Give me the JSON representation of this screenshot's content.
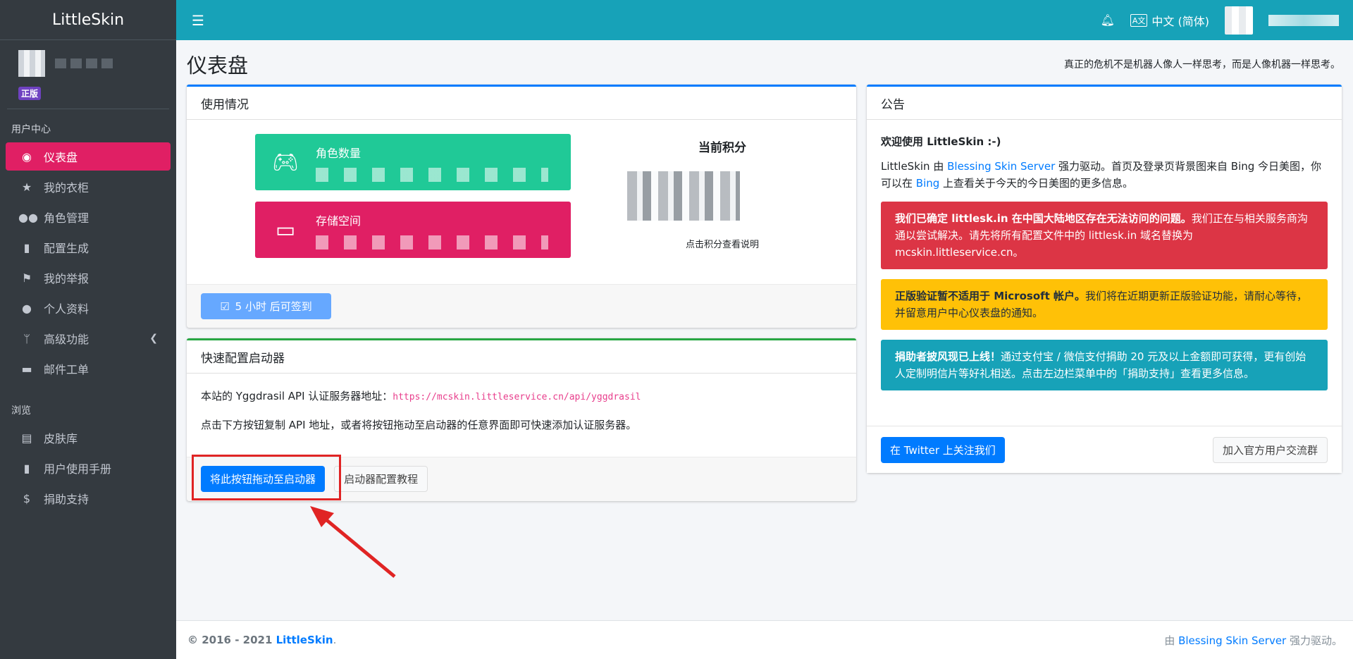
{
  "brand": "LittleSkin",
  "user": {
    "badge": "正版"
  },
  "topbar": {
    "menu_icon": "hamburger-icon",
    "language": "中文 (简体)",
    "language_icon": "translate-icon",
    "bell_icon": "bell-icon"
  },
  "nav": {
    "header_user": "用户中心",
    "items": [
      {
        "label": "仪表盘",
        "icon": "dashboard-icon"
      },
      {
        "label": "我的衣柜",
        "icon": "star-icon"
      },
      {
        "label": "角色管理",
        "icon": "users-icon"
      },
      {
        "label": "配置生成",
        "icon": "book-icon"
      },
      {
        "label": "我的举报",
        "icon": "flag-icon"
      },
      {
        "label": "个人资料",
        "icon": "user-icon"
      },
      {
        "label": "高级功能",
        "icon": "branch-icon"
      },
      {
        "label": "邮件工单",
        "icon": "ticket-icon"
      }
    ],
    "header_browse": "浏览",
    "browse_items": [
      {
        "label": "皮肤库",
        "icon": "archive-icon"
      },
      {
        "label": "用户使用手册",
        "icon": "manual-icon"
      },
      {
        "label": "捐助支持",
        "icon": "donate-icon"
      }
    ]
  },
  "page": {
    "title": "仪表盘",
    "quote": "真正的危机不是机器人像人一样思考，而是人像机器一样思考。"
  },
  "usage": {
    "title": "使用情况",
    "characters_label": "角色数量",
    "storage_label": "存储空间",
    "score_title": "当前积分",
    "score_note": "点击积分查看说明",
    "checkin_button": "5 小时 后可签到"
  },
  "launcher": {
    "title": "快速配置启动器",
    "api_text": "本站的 Yggdrasil API 认证服务器地址：",
    "api_url": "https://mcskin.littleservice.cn/api/yggdrasil",
    "instruction": "点击下方按钮复制 API 地址，或者将按钮拖动至启动器的任意界面即可快速添加认证服务器。",
    "drag_button": "将此按钮拖动至启动器",
    "tutorial_button": "启动器配置教程"
  },
  "announcement": {
    "title": "公告",
    "welcome": "欢迎使用 LittleSkin :-)",
    "intro_1": "LittleSkin 由 ",
    "intro_link_1": "Blessing Skin Server",
    "intro_2": " 强力驱动。首页及登录页背景图来自 Bing 今日美图，你可以在 ",
    "intro_link_2": "Bing",
    "intro_3": " 上查看关于今天的今日美图的更多信息。",
    "alert_danger_bold": "我们已确定 littlesk.in 在中国大陆地区存在无法访问的问题。",
    "alert_danger_text": "我们正在与相关服务商沟通以尝试解决。请先将所有配置文件中的 littlesk.in 域名替换为 mcskin.littleservice.cn。",
    "alert_warning_bold": "正版验证暂不适用于 Microsoft 帐户。",
    "alert_warning_text": "我们将在近期更新正版验证功能，请耐心等待，并留意用户中心仪表盘的通知。",
    "alert_info_bold": "捐助者披风现已上线！",
    "alert_info_text": "通过支付宝 / 微信支付捐助 20 元及以上金额即可获得，更有创始人定制明信片等好礼相送。点击左边栏菜单中的「捐助支持」查看更多信息。",
    "twitter_button": "在 Twitter 上关注我们",
    "group_button": "加入官方用户交流群"
  },
  "footer": {
    "copyright": "© 2016 - 2021 ",
    "brand_link": "LittleSkin",
    "powered_prefix": "由 ",
    "powered_link": "Blessing Skin Server",
    "powered_suffix": " 强力驱动。"
  },
  "colors": {
    "sidebar": "#343a40",
    "topbar": "#17a2b8",
    "active": "#e01f64",
    "primary": "#007bff",
    "success": "#20c997"
  }
}
